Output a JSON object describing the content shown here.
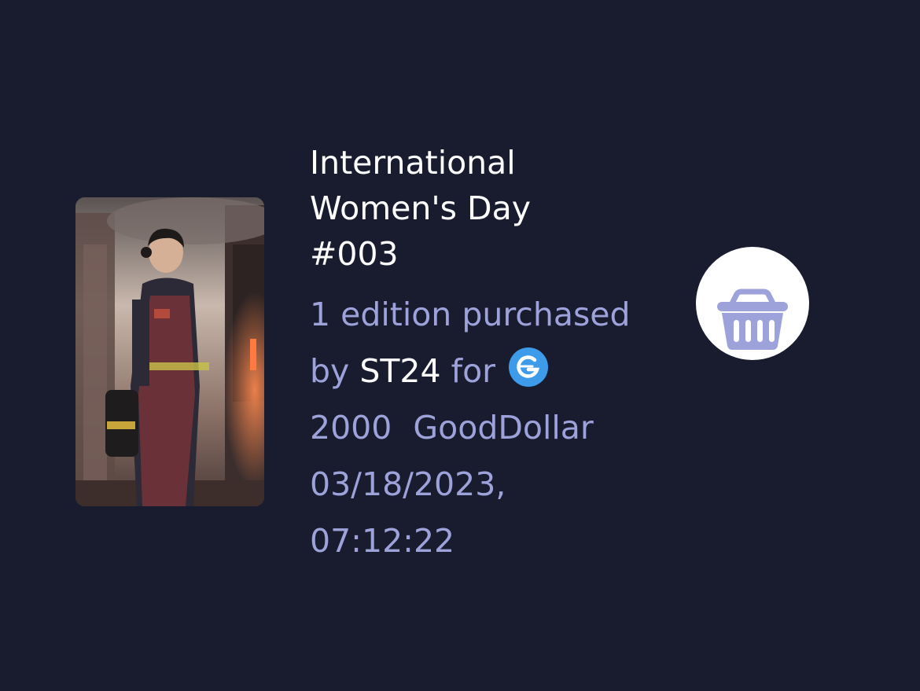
{
  "nft": {
    "image_alt": "Firefighter woman artwork",
    "title_line1": "International",
    "title_line2": "Women's Day",
    "title_line3": "#003"
  },
  "purchase": {
    "edition_text": "1 edition purchased",
    "by_label": "by",
    "buyer": "ST24",
    "for_label": "for",
    "token_icon": "gooddollar-icon",
    "amount": "2000",
    "currency": "GoodDollar",
    "date": "03/18/2023,",
    "time": "07:12:22"
  },
  "actions": {
    "basket_icon": "basket-icon"
  },
  "colors": {
    "background": "#181c2e",
    "muted_text": "#9ea2da",
    "token_blue": "#3d9be9",
    "basket_purple": "#9ea2da"
  }
}
